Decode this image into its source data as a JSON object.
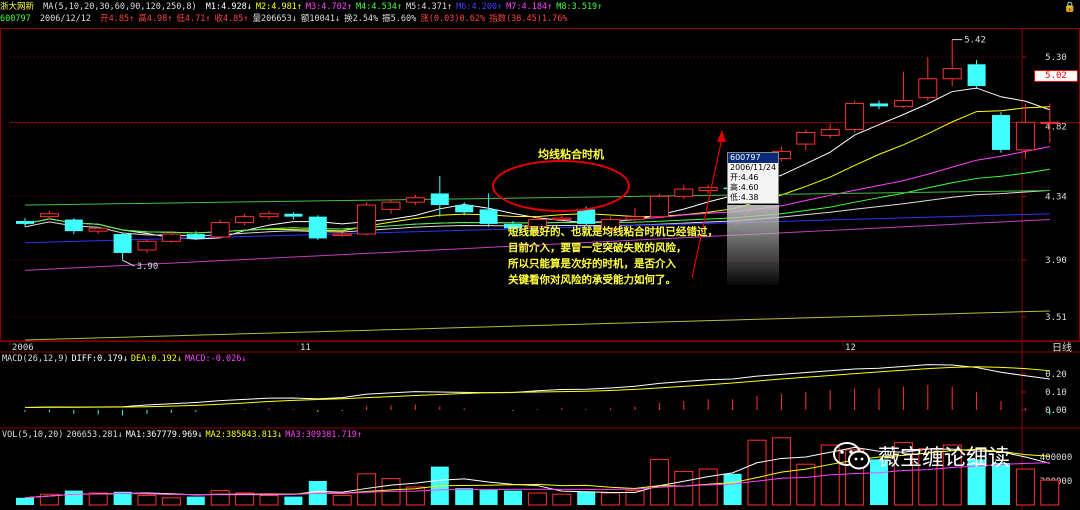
{
  "header": {
    "stock_name": "浙大网新",
    "ma_setting": "MA(5,10,20,30,60,90,120,250,8)",
    "ma_values": [
      {
        "text": "M1:4.928↓",
        "color": "#ffffff"
      },
      {
        "text": "M2:4.981↑",
        "color": "#ffff00"
      },
      {
        "text": "M3:4.702↑",
        "color": "#ff40ff"
      },
      {
        "text": "M4:4.534↑",
        "color": "#40ff40"
      },
      {
        "text": "M5:4.371↑",
        "color": "#dddddd"
      },
      {
        "text": "M6:4.200↑",
        "color": "#4040ff"
      },
      {
        "text": "M7:4.184↑",
        "color": "#ff40ff"
      },
      {
        "text": "M8:3.519↑",
        "color": "#40ff40"
      }
    ],
    "code": "600797",
    "date": "2006/12/12",
    "quote_items": [
      {
        "text": "开4.85↑",
        "color": "#ff4040"
      },
      {
        "text": "高4.98↑",
        "color": "#ff4040"
      },
      {
        "text": "低4.71↑",
        "color": "#ff4040"
      },
      {
        "text": "收4.85↑",
        "color": "#ff4040"
      },
      {
        "text": "量206653↓",
        "color": "#dddddd"
      },
      {
        "text": "额10041↓",
        "color": "#dddddd"
      },
      {
        "text": "换2.54%",
        "color": "#dddddd"
      },
      {
        "text": "振5.60%",
        "color": "#dddddd"
      },
      {
        "text": "涨(0.03)0.62%",
        "color": "#ff4040"
      },
      {
        "text": "指数(38.45)1.76%",
        "color": "#ff4040"
      }
    ]
  },
  "price_axis": {
    "labels": [
      "5.30",
      "4.82",
      "4.34",
      "3.90",
      "3.51"
    ],
    "current_price_tag": "5.02"
  },
  "date_axis": {
    "labels": [
      "2006",
      "11",
      "12"
    ],
    "period": "日线"
  },
  "annotations": {
    "high_label": "5.42",
    "low_label": "3.90",
    "title": "均线粘合时机",
    "text_lines": [
      "短线最好的、也就是均线粘合时机已经错过，",
      "目前介入，要冒一定突破失败的风险，",
      "所以只能算是次好的时机，是否介入",
      "关键看你对风险的承受能力如何了。"
    ]
  },
  "tooltip": {
    "code": "600797",
    "date": "2006/11/24",
    "open": "开:4.46",
    "high": "高:4.60",
    "low": "低:4.38"
  },
  "macd": {
    "title_items": [
      {
        "text": "MACD(26,12,9)",
        "color": "#dddddd"
      },
      {
        "text": "DIFF:0.179↓",
        "color": "#ffffff"
      },
      {
        "text": "DEA:0.192↓",
        "color": "#ffff00"
      },
      {
        "text": "MACD:-0.026↓",
        "color": "#ff40ff"
      }
    ],
    "axis_labels": [
      "0.20",
      "0.10",
      "0.00"
    ]
  },
  "volume": {
    "title_items": [
      {
        "text": "VOL(5,10,20)",
        "color": "#dddddd"
      },
      {
        "text": "206653.281↓",
        "color": "#dddddd"
      },
      {
        "text": "MA1:367779.969↓",
        "color": "#ffffff"
      },
      {
        "text": "MA2:385843.813↓",
        "color": "#ffff00"
      },
      {
        "text": "MA3:309381.719↑",
        "color": "#ff40ff"
      }
    ],
    "axis_labels": [
      "400000",
      "200000"
    ]
  },
  "watermark": {
    "text": "薇宝缠论细读",
    "icon": "wechat-icon"
  },
  "colors": {
    "up": "#ff3030",
    "down": "#40ffff",
    "grid": "#8b0000",
    "ma1": "#ffffff",
    "ma2": "#ffff00",
    "ma3": "#ff40ff",
    "ma4": "#40ff40",
    "ma5": "#dddddd",
    "ma6": "#3030ff",
    "ma8": "#40ff40"
  },
  "chart_data": {
    "type": "candlestick",
    "candles": [
      {
        "o": 4.17,
        "c": 4.15,
        "h": 4.19,
        "l": 4.13
      },
      {
        "o": 4.2,
        "c": 4.22,
        "h": 4.24,
        "l": 4.18
      },
      {
        "o": 4.18,
        "c": 4.1,
        "h": 4.19,
        "l": 4.08
      },
      {
        "o": 4.1,
        "c": 4.12,
        "h": 4.13,
        "l": 4.08
      },
      {
        "o": 4.08,
        "c": 3.95,
        "h": 4.09,
        "l": 3.9
      },
      {
        "o": 3.97,
        "c": 4.03,
        "h": 4.04,
        "l": 3.95
      },
      {
        "o": 4.03,
        "c": 4.08,
        "h": 4.1,
        "l": 4.02
      },
      {
        "o": 4.08,
        "c": 4.05,
        "h": 4.1,
        "l": 4.04
      },
      {
        "o": 4.06,
        "c": 4.16,
        "h": 4.18,
        "l": 4.05
      },
      {
        "o": 4.16,
        "c": 4.2,
        "h": 4.22,
        "l": 4.14
      },
      {
        "o": 4.2,
        "c": 4.22,
        "h": 4.24,
        "l": 4.18
      },
      {
        "o": 4.22,
        "c": 4.2,
        "h": 4.23,
        "l": 4.18
      },
      {
        "o": 4.2,
        "c": 4.05,
        "h": 4.21,
        "l": 4.04
      },
      {
        "o": 4.07,
        "c": 4.08,
        "h": 4.09,
        "l": 4.06
      },
      {
        "o": 4.08,
        "c": 4.28,
        "h": 4.3,
        "l": 4.07
      },
      {
        "o": 4.25,
        "c": 4.3,
        "h": 4.32,
        "l": 4.22
      },
      {
        "o": 4.3,
        "c": 4.33,
        "h": 4.35,
        "l": 4.28
      },
      {
        "o": 4.36,
        "c": 4.28,
        "h": 4.48,
        "l": 4.2
      },
      {
        "o": 4.28,
        "c": 4.23,
        "h": 4.3,
        "l": 4.21
      },
      {
        "o": 4.25,
        "c": 4.15,
        "h": 4.36,
        "l": 4.13
      },
      {
        "o": 4.15,
        "c": 4.12,
        "h": 4.17,
        "l": 4.08
      },
      {
        "o": 4.13,
        "c": 4.18,
        "h": 4.2,
        "l": 4.12
      },
      {
        "o": 4.18,
        "c": 4.19,
        "h": 4.22,
        "l": 4.16
      },
      {
        "o": 4.25,
        "c": 4.15,
        "h": 4.27,
        "l": 4.14
      },
      {
        "o": 4.12,
        "c": 4.18,
        "h": 4.2,
        "l": 4.1
      },
      {
        "o": 4.18,
        "c": 4.2,
        "h": 4.26,
        "l": 4.16
      },
      {
        "o": 4.2,
        "c": 4.34,
        "h": 4.36,
        "l": 4.19
      },
      {
        "o": 4.34,
        "c": 4.39,
        "h": 4.42,
        "l": 4.32
      },
      {
        "o": 4.38,
        "c": 4.4,
        "h": 4.42,
        "l": 4.36
      },
      {
        "o": 4.4,
        "c": 4.39,
        "h": 4.45,
        "l": 4.36
      },
      {
        "o": 4.46,
        "c": 4.6,
        "h": 4.6,
        "l": 4.38
      },
      {
        "o": 4.6,
        "c": 4.65,
        "h": 4.68,
        "l": 4.58
      },
      {
        "o": 4.7,
        "c": 4.78,
        "h": 4.8,
        "l": 4.66
      },
      {
        "o": 4.76,
        "c": 4.8,
        "h": 4.84,
        "l": 4.74
      },
      {
        "o": 4.8,
        "c": 4.98,
        "h": 5.0,
        "l": 4.78
      },
      {
        "o": 4.98,
        "c": 4.96,
        "h": 5.0,
        "l": 4.94
      },
      {
        "o": 4.96,
        "c": 5.0,
        "h": 5.2,
        "l": 4.95
      },
      {
        "o": 5.02,
        "c": 5.15,
        "h": 5.3,
        "l": 5.0
      },
      {
        "o": 5.15,
        "c": 5.22,
        "h": 5.42,
        "l": 5.1
      },
      {
        "o": 5.25,
        "c": 5.1,
        "h": 5.28,
        "l": 5.08
      },
      {
        "o": 4.9,
        "c": 4.66,
        "h": 4.92,
        "l": 4.64
      },
      {
        "o": 4.66,
        "c": 4.85,
        "h": 4.98,
        "l": 4.6
      },
      {
        "o": 4.85,
        "c": 4.85,
        "h": 4.98,
        "l": 4.71
      }
    ],
    "volumes": [
      {
        "v": 60000,
        "up": false
      },
      {
        "v": 90000,
        "up": true
      },
      {
        "v": 120000,
        "up": false
      },
      {
        "v": 100000,
        "up": true
      },
      {
        "v": 110000,
        "up": false
      },
      {
        "v": 80000,
        "up": true
      },
      {
        "v": 60000,
        "up": true
      },
      {
        "v": 70000,
        "up": false
      },
      {
        "v": 120000,
        "up": true
      },
      {
        "v": 100000,
        "up": true
      },
      {
        "v": 80000,
        "up": true
      },
      {
        "v": 70000,
        "up": false
      },
      {
        "v": 200000,
        "up": false
      },
      {
        "v": 80000,
        "up": true
      },
      {
        "v": 260000,
        "up": true
      },
      {
        "v": 220000,
        "up": true
      },
      {
        "v": 150000,
        "up": true
      },
      {
        "v": 320000,
        "up": false
      },
      {
        "v": 140000,
        "up": false
      },
      {
        "v": 130000,
        "up": false
      },
      {
        "v": 120000,
        "up": false
      },
      {
        "v": 100000,
        "up": true
      },
      {
        "v": 90000,
        "up": true
      },
      {
        "v": 110000,
        "up": false
      },
      {
        "v": 100000,
        "up": true
      },
      {
        "v": 120000,
        "up": true
      },
      {
        "v": 380000,
        "up": true
      },
      {
        "v": 280000,
        "up": true
      },
      {
        "v": 300000,
        "up": true
      },
      {
        "v": 260000,
        "up": false
      },
      {
        "v": 540000,
        "up": true
      },
      {
        "v": 560000,
        "up": true
      },
      {
        "v": 340000,
        "up": true
      },
      {
        "v": 500000,
        "up": true
      },
      {
        "v": 460000,
        "up": true
      },
      {
        "v": 380000,
        "up": false
      },
      {
        "v": 520000,
        "up": true
      },
      {
        "v": 470000,
        "up": true
      },
      {
        "v": 500000,
        "up": true
      },
      {
        "v": 380000,
        "up": false
      },
      {
        "v": 350000,
        "up": false
      },
      {
        "v": 300000,
        "up": true
      },
      {
        "v": 206653,
        "up": true
      }
    ],
    "macd_hist": [
      -0.01,
      -0.012,
      -0.02,
      -0.025,
      -0.03,
      -0.02,
      -0.015,
      -0.01,
      0.0,
      0.005,
      0.01,
      0.005,
      -0.01,
      -0.005,
      0.02,
      0.025,
      0.03,
      0.02,
      0.01,
      0.0,
      -0.005,
      0.005,
      0.01,
      0.005,
      0.01,
      0.02,
      0.04,
      0.05,
      0.06,
      0.06,
      0.08,
      0.09,
      0.1,
      0.11,
      0.12,
      0.12,
      0.13,
      0.14,
      0.13,
      0.1,
      0.05,
      0.01,
      -0.026
    ],
    "ylim": [
      3.35,
      5.5
    ],
    "xlabel": "",
    "ylabel": ""
  }
}
